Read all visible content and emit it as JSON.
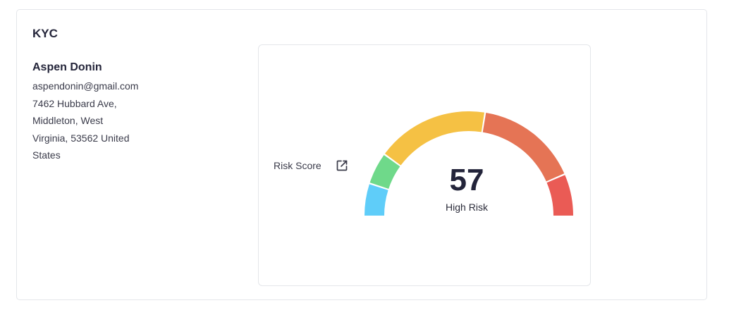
{
  "card": {
    "title": "KYC"
  },
  "person": {
    "name": "Aspen Donin",
    "email": "aspendonin@gmail.com",
    "address_lines": [
      "7462 Hubbard Ave,",
      "Middleton, West",
      "Virginia, 53562 United",
      "States"
    ]
  },
  "risk": {
    "label": "Risk Score",
    "score": "57",
    "level": "High Risk",
    "open_icon": "external-link-icon"
  },
  "gauge": {
    "min": 0,
    "max": 100,
    "segments": [
      {
        "from": 0,
        "to": 10,
        "color": "#5fcdf9"
      },
      {
        "from": 10,
        "to": 20,
        "color": "#6fd98a"
      },
      {
        "from": 20,
        "to": 55,
        "color": "#f5c144"
      },
      {
        "from": 55,
        "to": 87,
        "color": "#e57455"
      },
      {
        "from": 87,
        "to": 100,
        "color": "#ea5b55"
      }
    ]
  },
  "colors": {
    "border": "#e4e6ea",
    "text": "#24253a"
  }
}
